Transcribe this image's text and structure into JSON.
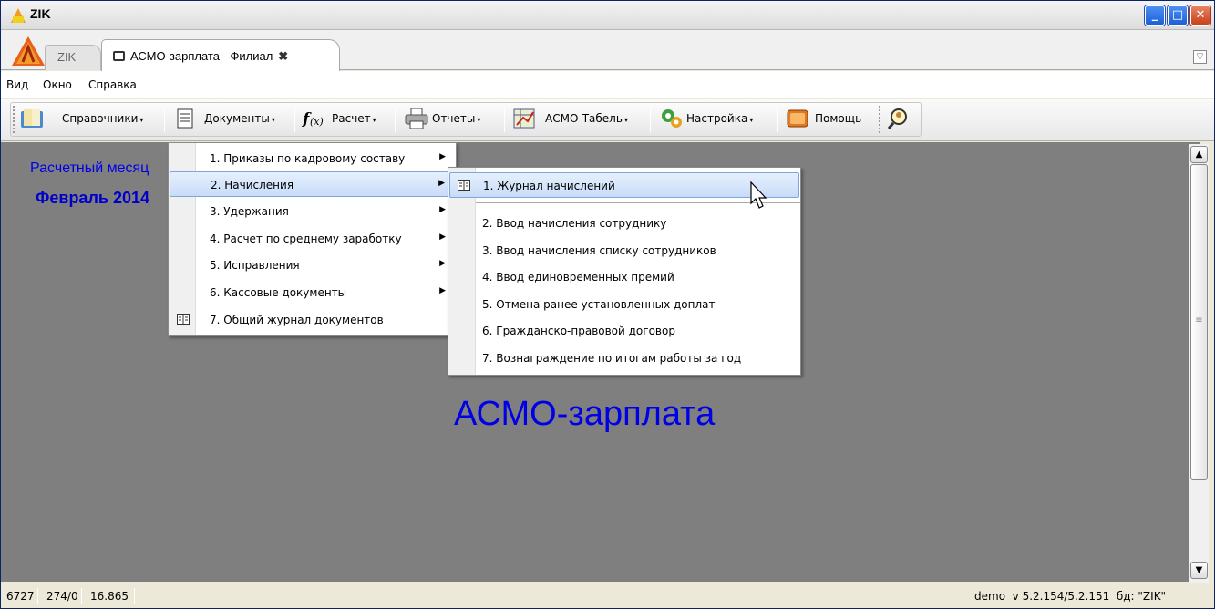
{
  "window": {
    "title": "ZIK",
    "min": "_",
    "max": "□",
    "close": "✕"
  },
  "tabs": [
    {
      "label": "ZIK"
    },
    {
      "label": "АСМО-зарплата - Филиал",
      "close": "✖"
    }
  ],
  "tab_dropdown": "▽",
  "menubar": [
    "Вид",
    "Окно",
    "Справка"
  ],
  "toolbar": {
    "ref": "Справочники",
    "docs": "Документы",
    "calc": "Расчет",
    "reports": "Отчеты",
    "tabel": "АСМО-Табель",
    "settings": "Настройка",
    "help": "Помощь",
    "arrow": "▾"
  },
  "content": {
    "month_label": "Расчетный месяц",
    "month_value": "Февраль 2014",
    "app_title": "АСМО-зарплата"
  },
  "menu_documents": [
    {
      "label": "1. Приказы по кадровому составу",
      "submenu": true
    },
    {
      "label": "2. Начисления",
      "submenu": true,
      "highlighted": true
    },
    {
      "label": "3. Удержания",
      "submenu": true
    },
    {
      "label": "4. Расчет по среднему заработку",
      "submenu": true
    },
    {
      "label": "5. Исправления",
      "submenu": true
    },
    {
      "label": "6. Кассовые документы",
      "submenu": true
    },
    {
      "label": "7. Общий журнал документов",
      "submenu": false,
      "icon": "book-icon"
    }
  ],
  "menu_accruals": [
    {
      "label": "1. Журнал начислений",
      "icon": "book-icon",
      "highlighted": true
    },
    {
      "label": "2. Ввод начисления сотруднику"
    },
    {
      "label": "3. Ввод начисления списку сотрудников"
    },
    {
      "label": "4. Ввод единовременных премий"
    },
    {
      "label": "5. Отмена ранее установленных доплат"
    },
    {
      "label": "6. Гражданско-правовой договор"
    },
    {
      "label": "7. Вознаграждение по итогам работы за год"
    }
  ],
  "submenu_arrow": "▶",
  "statusbar": {
    "s1": "6727",
    "s2": "274/0",
    "s3": "16.865",
    "right": "demo  v 5.2.154/5.2.151  бд: \"ZIK\""
  },
  "colors": {
    "content_bg": "#7f7f7f",
    "title_blue": "#0000e6",
    "highlight": "#c8dcf8"
  }
}
